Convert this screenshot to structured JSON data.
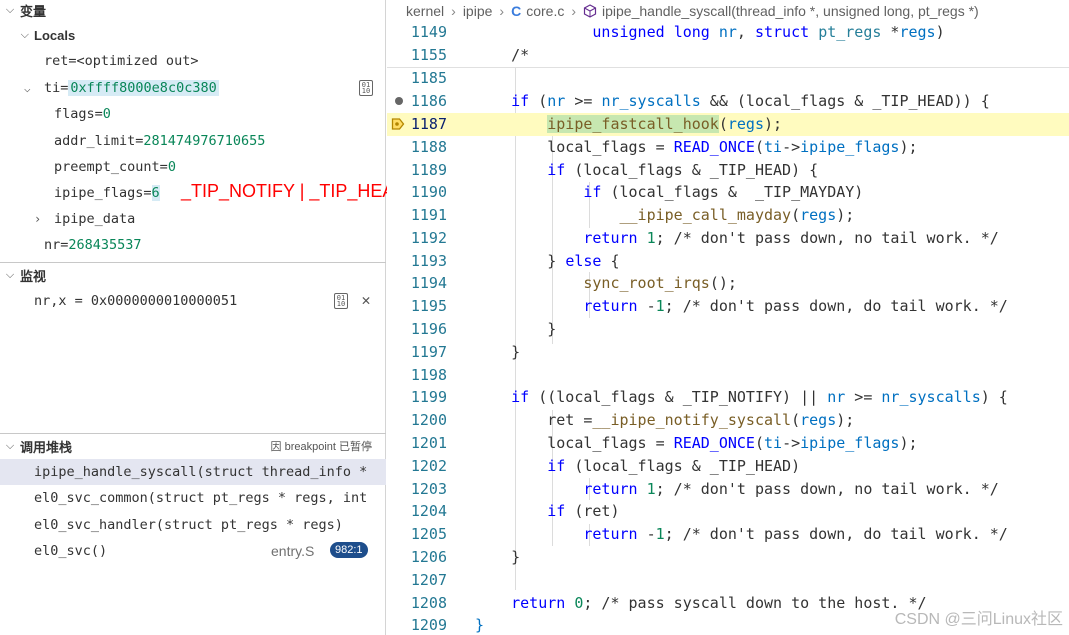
{
  "variables_section": {
    "title": "变量",
    "locals_title": "Locals",
    "rows": [
      {
        "name": "ret",
        "value": "<optimized out>"
      },
      {
        "name": "ti",
        "value": "0xffff8000e8c0c380"
      },
      {
        "name": "flags",
        "value": "0"
      },
      {
        "name": "addr_limit",
        "value": "281474976710655"
      },
      {
        "name": "preempt_count",
        "value": "0"
      },
      {
        "name": "ipipe_flags",
        "value": "6"
      },
      {
        "name": "ipipe_data",
        "value": ""
      },
      {
        "name": "nr",
        "value": "268435537"
      }
    ],
    "annotation": "_TIP_NOTIFY | _TIP_HEAD"
  },
  "watch_section": {
    "title": "监视",
    "expression": "nr,x = 0x0000000010000051"
  },
  "callstack_section": {
    "title": "调用堆栈",
    "status": "因 breakpoint 已暂停",
    "frames": [
      {
        "label": "ipipe_handle_syscall(struct thread_info *"
      },
      {
        "label": "el0_svc_common(struct pt_regs * regs, int"
      },
      {
        "label": "el0_svc_handler(struct pt_regs * regs)"
      },
      {
        "label": "el0_svc()",
        "file": "entry.S",
        "badge": "982:1"
      }
    ]
  },
  "breadcrumb": {
    "items": [
      "kernel",
      "ipipe",
      "core.c",
      "ipipe_handle_syscall(thread_info *, unsigned long, pt_regs *)"
    ]
  },
  "editor": {
    "sticky": [
      {
        "num": "1149"
      },
      {
        "num": "1155"
      }
    ],
    "line_numbers": [
      "1185",
      "1186",
      "1187",
      "1188",
      "1189",
      "1190",
      "1191",
      "1192",
      "1193",
      "1194",
      "1195",
      "1196",
      "1197",
      "1198",
      "1199",
      "1200",
      "1201",
      "1202",
      "1203",
      "1204",
      "1205",
      "1206",
      "1207",
      "1208",
      "1209"
    ],
    "breakpoint_line": "1186",
    "current_line": "1187"
  },
  "watermark": "CSDN @三问Linux社区",
  "colors": {
    "accent": "#3b7ddd",
    "current_line_bg": "#fffbbf",
    "annotation": "#ff0000"
  }
}
